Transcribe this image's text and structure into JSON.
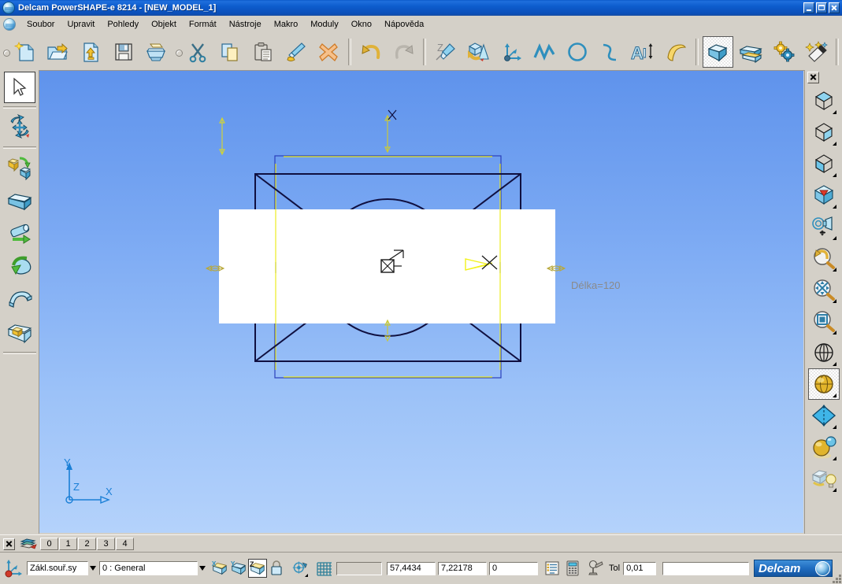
{
  "window": {
    "title": "Delcam PowerSHAPE-e 8214 - [NEW_MODEL_1]",
    "app_icon": "delcam-globe-icon",
    "controls": [
      {
        "name": "minimize",
        "glyph": "_"
      },
      {
        "name": "maximize",
        "glyph": "□"
      },
      {
        "name": "close",
        "glyph": "×"
      }
    ]
  },
  "menu": {
    "icon": "document-globe-icon",
    "items": [
      {
        "label": "Soubor"
      },
      {
        "label": "Upravit"
      },
      {
        "label": "Pohledy"
      },
      {
        "label": "Objekt"
      },
      {
        "label": "Formát"
      },
      {
        "label": "Nástroje"
      },
      {
        "label": "Makro"
      },
      {
        "label": "Moduly"
      },
      {
        "label": "Okno"
      },
      {
        "label": "Nápověda"
      }
    ]
  },
  "toolbar": {
    "buttons": [
      {
        "name": "new-model-button",
        "icon": "new-document-icon",
        "selected": false
      },
      {
        "name": "open-model-button",
        "icon": "open-folder-icon",
        "selected": false
      },
      {
        "name": "import-button",
        "icon": "import-arrow-up-icon",
        "selected": false
      },
      {
        "name": "save-button",
        "icon": "floppy-disk-icon",
        "selected": false
      },
      {
        "name": "print-button",
        "icon": "printer-icon",
        "selected": false
      },
      {
        "name": "cut-button",
        "icon": "scissors-icon",
        "selected": false
      },
      {
        "name": "copy-button",
        "icon": "copy-pages-icon",
        "selected": false
      },
      {
        "name": "paste-button",
        "icon": "clipboard-icon",
        "selected": false
      },
      {
        "name": "paste-special-button",
        "icon": "paint-brush-icon",
        "selected": false
      },
      {
        "name": "delete-button",
        "icon": "orange-cross-icon",
        "selected": false
      },
      {
        "name": "undo-button",
        "icon": "undo-arrow-icon",
        "selected": false
      },
      {
        "name": "redo-button",
        "icon": "redo-arrow-icon",
        "selected": false
      },
      {
        "name": "zebra-edit-button",
        "icon": "pencil-z-icon",
        "selected": false
      },
      {
        "name": "solid-surface-button",
        "icon": "solid-cone-icon",
        "selected": false
      },
      {
        "name": "workplane-button",
        "icon": "axis-workplane-icon",
        "selected": false
      },
      {
        "name": "line-button",
        "icon": "polyline-icon",
        "selected": false
      },
      {
        "name": "circle-button",
        "icon": "circle-icon",
        "selected": false
      },
      {
        "name": "curve-button",
        "icon": "curve-icon",
        "selected": false
      },
      {
        "name": "text-button",
        "icon": "text-A-icon",
        "selected": false
      },
      {
        "name": "surface-button",
        "icon": "yellow-surface-icon",
        "selected": false
      },
      {
        "name": "solid-button",
        "icon": "blue-cube-icon",
        "selected": true
      },
      {
        "name": "assembly-button",
        "icon": "stacked-blocks-icon",
        "selected": false
      },
      {
        "name": "machining-button",
        "icon": "gears-icon",
        "selected": false
      },
      {
        "name": "wizard-button",
        "icon": "magic-wand-icon",
        "selected": false
      }
    ]
  },
  "left_toolbar": {
    "buttons": [
      {
        "name": "select-tool",
        "icon": "arrow-cursor-icon",
        "selected": true,
        "has_arrow": true
      },
      {
        "name": "transform-tool",
        "icon": "move-rotate-icon",
        "selected": false,
        "has_arrow": false
      },
      {
        "name": "solid-primitive-tool",
        "icon": "two-cubes-arrow-icon",
        "selected": false,
        "has_arrow": false
      },
      {
        "name": "solid-block-tool",
        "icon": "blue-block-icon",
        "selected": false,
        "has_arrow": true
      },
      {
        "name": "solid-extrusion-tool",
        "icon": "cylinder-arrow-icon",
        "selected": false,
        "has_arrow": false
      },
      {
        "name": "solid-revolution-tool",
        "icon": "revolve-arrow-icon",
        "selected": false,
        "has_arrow": false
      },
      {
        "name": "solid-sweep-tool",
        "icon": "sweep-surface-icon",
        "selected": false,
        "has_arrow": false
      },
      {
        "name": "solid-boolean-tool",
        "icon": "boolean-cube-icon",
        "selected": false,
        "has_arrow": false
      }
    ]
  },
  "right_toolbar": {
    "close_label": "×",
    "buttons": [
      {
        "name": "view-iso1-button",
        "icon": "cube-top-face-icon",
        "selected": false,
        "has_arrow": true
      },
      {
        "name": "view-iso2-button",
        "icon": "cube-right-face-icon",
        "selected": false,
        "has_arrow": true
      },
      {
        "name": "view-front-button",
        "icon": "cube-front-face-icon",
        "selected": false,
        "has_arrow": true
      },
      {
        "name": "view-dynamic-button",
        "icon": "cube-red-arrow-icon",
        "selected": false,
        "has_arrow": true
      },
      {
        "name": "view-camera-button",
        "icon": "camera-view-icon",
        "selected": false,
        "has_arrow": true
      },
      {
        "name": "zoom-previous-button",
        "icon": "undo-magnifier-icon",
        "selected": false,
        "has_arrow": true
      },
      {
        "name": "zoom-fit-button",
        "icon": "zoom-fit-magnifier-icon",
        "selected": false,
        "has_arrow": true
      },
      {
        "name": "zoom-box-button",
        "icon": "zoom-box-magnifier-icon",
        "selected": false,
        "has_arrow": true
      },
      {
        "name": "wireframe-shade-button",
        "icon": "wireframe-globe-icon",
        "selected": false,
        "has_arrow": true
      },
      {
        "name": "shaded-view-button",
        "icon": "gold-sphere-icon",
        "selected": true,
        "has_arrow": true
      },
      {
        "name": "section-view-button",
        "icon": "blue-diamond-section-icon",
        "selected": false,
        "has_arrow": true
      },
      {
        "name": "material-button",
        "icon": "gold-blue-spheres-icon",
        "selected": false,
        "has_arrow": true
      },
      {
        "name": "lighting-button",
        "icon": "light-bulb-icon",
        "selected": false,
        "has_arrow": true
      }
    ]
  },
  "viewport": {
    "background_top_color": "#5f93ec",
    "background_bottom_color": "#b4d2fb",
    "annotation": "Délka=120",
    "annotation_color": "#8a8a8a",
    "axis_triad": {
      "x_label": "X",
      "y_label": "Y",
      "z_label": "Z",
      "color": "#1a7fd6"
    },
    "model_colors": {
      "solid_white": "#ffffff",
      "wireframe_black": "#101040",
      "box_blue": "#2a3fbb",
      "guide_yellow": "#f2f21a"
    },
    "markers": [
      {
        "name": "origin-marker",
        "icon": "crossed-box-icon"
      },
      {
        "name": "extrude-handle-marker",
        "icon": "yellow-arrow-cross-icon"
      }
    ]
  },
  "layerstrip": {
    "close_label": "×",
    "layers_icon": "layers-stack-icon",
    "tabs": [
      "0",
      "1",
      "2",
      "3",
      "4"
    ]
  },
  "statusbar": {
    "workplane_icon": "workplane-axes-icon",
    "workplane_combo": {
      "value": "Zákl.souř.sy",
      "name": "workplane-select"
    },
    "level_combo": {
      "value": "0    : General",
      "name": "level-select"
    },
    "principal_axis_buttons": [
      {
        "name": "principal-plane-x-button",
        "icon": "x-plane-cube-icon",
        "selected": false
      },
      {
        "name": "principal-plane-y-button",
        "icon": "y-plane-cube-icon",
        "selected": false
      },
      {
        "name": "principal-plane-z-button",
        "icon": "z-plane-cube-icon",
        "selected": true
      },
      {
        "name": "lock-plane-button",
        "icon": "padlock-icon",
        "selected": false
      }
    ],
    "dynamic_sectioning_button": {
      "name": "dynamic-section-button",
      "icon": "section-eye-icon"
    },
    "grid_button": {
      "name": "grid-snap-button",
      "icon": "grid-icon"
    },
    "command_field": {
      "value": "",
      "name": "command-input"
    },
    "coord_x": "57,4434",
    "coord_y": "7,22178",
    "coord_z": "0",
    "list_button": {
      "name": "command-history-button",
      "icon": "list-lines-icon"
    },
    "calculator_button": {
      "name": "calculator-button",
      "icon": "calculator-icon"
    },
    "macro_button": {
      "name": "macro-record-button",
      "icon": "projector-icon"
    },
    "tolerance_label": "Tol",
    "tolerance_value": "0,01",
    "message_field": {
      "value": "",
      "name": "message-input"
    },
    "brand": {
      "text": "Delcam",
      "icon": "delcam-globe-icon",
      "color": "#1f6cc0"
    }
  }
}
